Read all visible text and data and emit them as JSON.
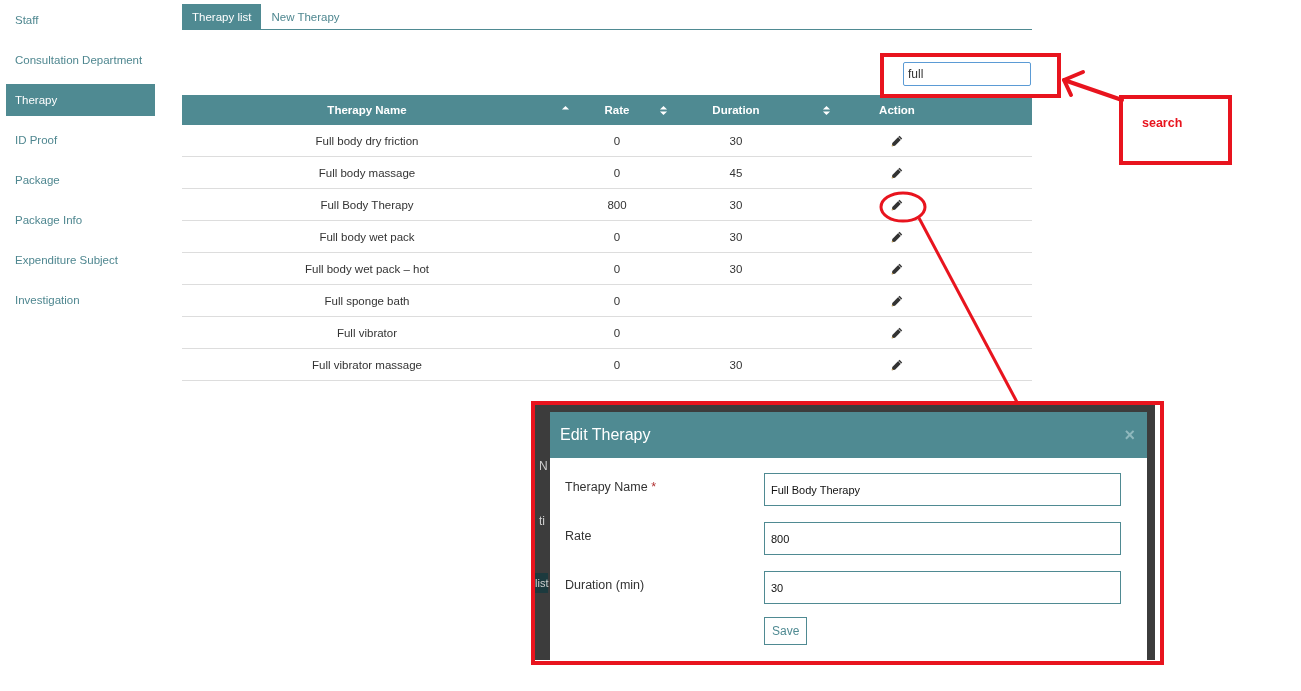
{
  "sidebar": {
    "items": [
      {
        "label": "Staff",
        "selected": false
      },
      {
        "label": "Consultation Department",
        "selected": false
      },
      {
        "label": "Therapy",
        "selected": true
      },
      {
        "label": "ID Proof",
        "selected": false
      },
      {
        "label": "Package",
        "selected": false
      },
      {
        "label": "Package Info",
        "selected": false
      },
      {
        "label": "Expenditure Subject",
        "selected": false
      },
      {
        "label": "Investigation",
        "selected": false
      }
    ]
  },
  "tabs": [
    {
      "label": "Therapy list",
      "selected": true
    },
    {
      "label": "New Therapy",
      "selected": false
    }
  ],
  "search": {
    "value": "full"
  },
  "table": {
    "columns": [
      {
        "label": "Therapy Name",
        "sortable": true,
        "sorted": true
      },
      {
        "label": "Rate",
        "sortable": true,
        "sorted": false
      },
      {
        "label": "Duration",
        "sortable": true,
        "sorted": false
      },
      {
        "label": "Action",
        "sortable": false
      }
    ],
    "rows": [
      {
        "name": "Full body dry friction",
        "rate": "0",
        "duration": "30"
      },
      {
        "name": "Full body massage",
        "rate": "0",
        "duration": "45"
      },
      {
        "name": "Full Body Therapy",
        "rate": "800",
        "duration": "30"
      },
      {
        "name": "Full body wet pack",
        "rate": "0",
        "duration": "30"
      },
      {
        "name": "Full body wet pack – hot",
        "rate": "0",
        "duration": "30"
      },
      {
        "name": "Full sponge bath",
        "rate": "0"
      },
      {
        "name": "Full vibrator",
        "rate": "0"
      },
      {
        "name": "Full vibrator massage",
        "rate": "0",
        "duration": "30"
      }
    ]
  },
  "backdrop_fragments": [
    "N",
    "ti",
    "list"
  ],
  "modal": {
    "title": "Edit Therapy",
    "close": "×",
    "fields": [
      {
        "label": "Therapy Name",
        "required": true,
        "value": "Full Body Therapy"
      },
      {
        "label": "Rate",
        "required": false,
        "value": "800"
      },
      {
        "label": "Duration (min)",
        "required": false,
        "value": "30"
      }
    ],
    "required_mark": "*",
    "save": "Save"
  },
  "annotations": {
    "search_label": "search"
  }
}
